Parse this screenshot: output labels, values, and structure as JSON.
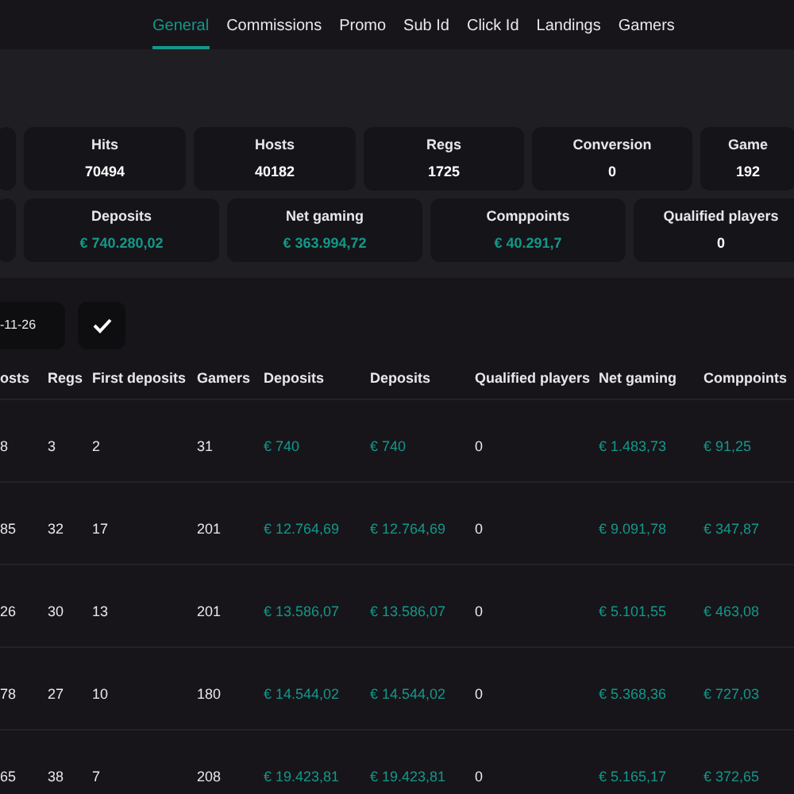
{
  "tabs": [
    {
      "label": "General",
      "selected": true
    },
    {
      "label": "Commissions",
      "selected": false
    },
    {
      "label": "Promo",
      "selected": false
    },
    {
      "label": "Sub Id",
      "selected": false
    },
    {
      "label": "Click Id",
      "selected": false
    },
    {
      "label": "Landings",
      "selected": false
    },
    {
      "label": "Gamers",
      "selected": false
    }
  ],
  "stats_row_1": [
    {
      "label": "Hits",
      "value": "70494"
    },
    {
      "label": "Hosts",
      "value": "40182"
    },
    {
      "label": "Regs",
      "value": "1725"
    },
    {
      "label": "Conversion",
      "value": "0"
    },
    {
      "label": "Game",
      "value": "192"
    }
  ],
  "stats_row_2": [
    {
      "label": "Deposits",
      "value": "€ 740.280,02",
      "kind": "money"
    },
    {
      "label": "Net gaming",
      "value": "€ 363.994,72",
      "kind": "money"
    },
    {
      "label": "Comppoints",
      "value": "€ 40.291,7",
      "kind": "money"
    },
    {
      "label": "Qualified players",
      "value": "0",
      "kind": "count"
    }
  ],
  "date_field": {
    "value": "-11-26"
  },
  "table": {
    "columns": [
      {
        "label": "osts",
        "kind": "count"
      },
      {
        "label": "Regs",
        "kind": "count"
      },
      {
        "label": "First deposits",
        "kind": "count"
      },
      {
        "label": "Gamers",
        "kind": "count"
      },
      {
        "label": "Deposits",
        "kind": "money"
      },
      {
        "label": "Deposits",
        "kind": "money"
      },
      {
        "label": "Qualified players",
        "kind": "count"
      },
      {
        "label": "Net gaming",
        "kind": "money"
      },
      {
        "label": "Comppoints",
        "kind": "money"
      }
    ],
    "rows": [
      [
        "8",
        "3",
        "2",
        "31",
        "€ 740",
        "€ 740",
        "0",
        "€ 1.483,73",
        "€ 91,25"
      ],
      [
        "85",
        "32",
        "17",
        "201",
        "€ 12.764,69",
        "€ 12.764,69",
        "0",
        "€ 9.091,78",
        "€ 347,87"
      ],
      [
        "26",
        "30",
        "13",
        "201",
        "€ 13.586,07",
        "€ 13.586,07",
        "0",
        "€ 5.101,55",
        "€ 463,08"
      ],
      [
        "78",
        "27",
        "10",
        "180",
        "€ 14.544,02",
        "€ 14.544,02",
        "0",
        "€ 5.368,36",
        "€ 727,03"
      ],
      [
        "65",
        "38",
        "7",
        "208",
        "€ 19.423,81",
        "€ 19.423,81",
        "0",
        "€ 5.165,17",
        "€ 372,65"
      ]
    ]
  }
}
